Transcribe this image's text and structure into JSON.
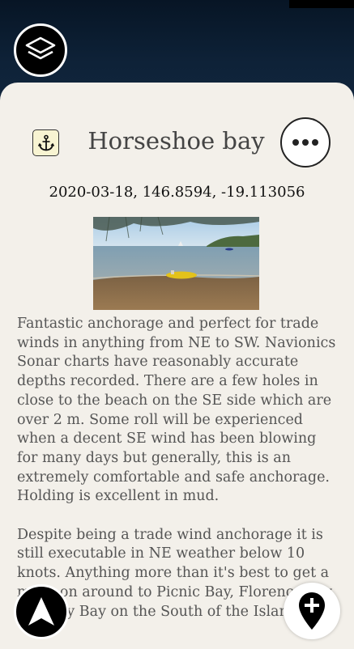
{
  "place": {
    "title": "Horseshoe bay",
    "coordinates": "2020-03-18, 146.8594, -19.113056",
    "type_icon": "anchor-icon"
  },
  "description": {
    "paragraphs": [
      "Fantastic anchorage and perfect for trade winds in anything from NE to SW. Navionics Sonar charts have reasonably accurate depths recorded. There are a few holes in close to the beach on the SE side which are over 2 m. Some roll will be experienced when a decent SE wind has been blowing for many days but generally, this is an extremely comfortable and safe anchorage. Holding is excellent in mud.",
      "Despite being a trade wind anchorage it is still executable in NE weather below 10 knots. Anything more than it's best to get a move on around to Picnic Bay, Florence bay or Nelly Bay on the South of the Island."
    ]
  },
  "buttons": {
    "layers_icon": "layers-icon",
    "more_icon": "more-dots-icon",
    "navigate_icon": "navigation-arrow-icon",
    "add_pin_icon": "add-pin-icon"
  },
  "colors": {
    "sheet_background": "#f3f0ea",
    "map_background": "#0d1c2f",
    "badge_background": "#f8f4d2"
  }
}
